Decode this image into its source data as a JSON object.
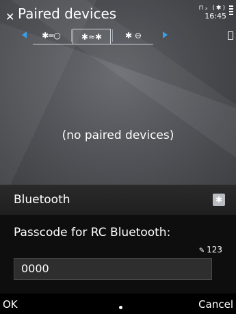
{
  "header": {
    "title": "Paired devices",
    "time": "16:45",
    "status_indicators": "⊓ₓ (✱)"
  },
  "tabs": [
    {
      "label": "✱═○",
      "icon": "bt-audio-icon"
    },
    {
      "label": "✱≈✱",
      "icon": "bt-devices-icon"
    },
    {
      "label": "✱ ⊖",
      "icon": "bt-other-icon"
    }
  ],
  "main": {
    "empty_text": "(no paired devices)"
  },
  "dialog": {
    "title": "Bluetooth",
    "prompt": "Passcode for RC Bluetooth:",
    "input_mode": "123",
    "passcode": "0000"
  },
  "softkeys": {
    "left": "OK",
    "right": "Cancel"
  },
  "colors": {
    "accent": "#3aa0e8",
    "dialog_bg": "#0e0e0e",
    "input_bg": "#2e2e2e"
  }
}
